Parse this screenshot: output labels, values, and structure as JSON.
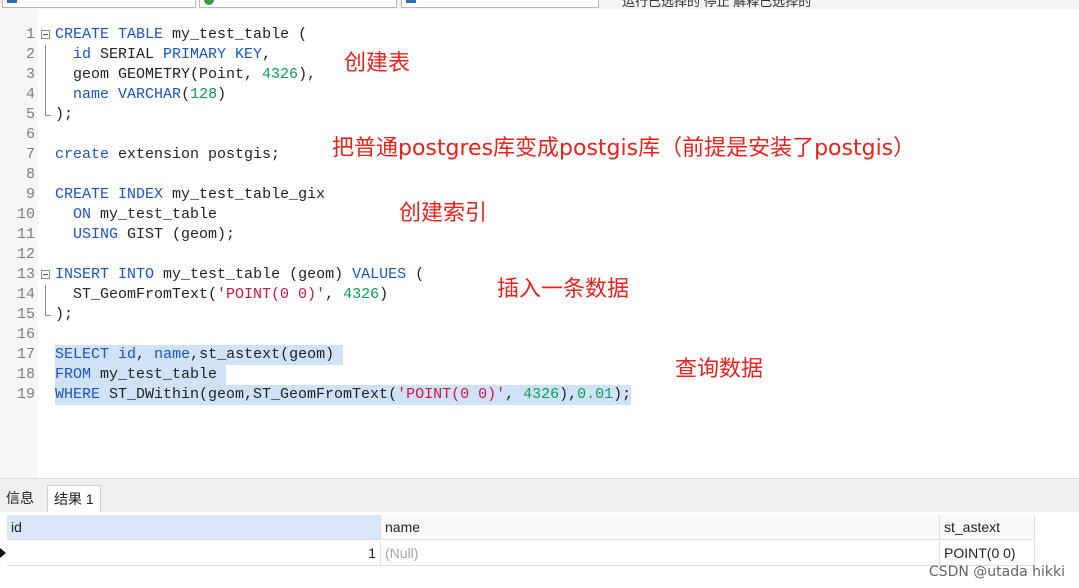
{
  "toolbar": {
    "partial_text": "运行已选择的    停止    解释已选择的"
  },
  "editor": {
    "lines": [
      {
        "n": "1",
        "fold": "start",
        "html": "<span class=\"kw\">CREATE</span> <span class=\"kw\">TABLE</span> my_test_table ("
      },
      {
        "n": "2",
        "fold": "mid",
        "html": "  <span class=\"kw\">id</span> SERIAL <span class=\"kw\">PRIMARY KEY</span>,"
      },
      {
        "n": "3",
        "fold": "mid",
        "html": "  geom GEOMETRY(Point, <span class=\"num\">4326</span>),"
      },
      {
        "n": "4",
        "fold": "mid",
        "html": "  <span class=\"kw\">name</span> <span class=\"kw\">VARCHAR</span>(<span class=\"num\">128</span>)"
      },
      {
        "n": "5",
        "fold": "end",
        "html": ");"
      },
      {
        "n": "6",
        "fold": "",
        "html": ""
      },
      {
        "n": "7",
        "fold": "",
        "html": "<span class=\"kw\">create</span> extension postgis;"
      },
      {
        "n": "8",
        "fold": "",
        "html": ""
      },
      {
        "n": "9",
        "fold": "",
        "html": "<span class=\"kw\">CREATE</span> <span class=\"kw\">INDEX</span> my_test_table_gix"
      },
      {
        "n": "10",
        "fold": "",
        "html": "  <span class=\"kw\">ON</span> my_test_table"
      },
      {
        "n": "11",
        "fold": "",
        "html": "  <span class=\"kw\">USING</span> GIST (geom);"
      },
      {
        "n": "12",
        "fold": "",
        "html": ""
      },
      {
        "n": "13",
        "fold": "start",
        "html": "<span class=\"kw\">INSERT</span> <span class=\"kw\">INTO</span> my_test_table (geom) <span class=\"kw\">VALUES</span> ("
      },
      {
        "n": "14",
        "fold": "mid",
        "html": "  ST_GeomFromText(<span class=\"str\">'POINT(0 0)'</span>, <span class=\"num\">4326</span>)"
      },
      {
        "n": "15",
        "fold": "end",
        "html": ");"
      },
      {
        "n": "16",
        "fold": "",
        "html": ""
      },
      {
        "n": "17",
        "fold": "",
        "hl": true,
        "html": "<span class=\"kw\">SELECT</span> <span class=\"kw\">id</span>, <span class=\"kw\">name</span>,st_astext(geom) "
      },
      {
        "n": "18",
        "fold": "",
        "hl": true,
        "html": "<span class=\"kw\">FROM</span> my_test_table "
      },
      {
        "n": "19",
        "fold": "",
        "hl": true,
        "html": "<span class=\"kw\">WHERE</span> ST_DWithin(geom,ST_GeomFromText(<span class=\"str\">'POINT(0 0)'</span>, <span class=\"num\">4326</span>),<span class=\"num\">0.01</span>);"
      }
    ]
  },
  "annotations": {
    "create_table": "创建表",
    "extension": "把普通postgres库变成postgis库（前提是安装了postgis）",
    "create_index": "创建索引",
    "insert": "插入一条数据",
    "query": "查询数据"
  },
  "result_panel": {
    "tabs": [
      "信息",
      "结果 1"
    ],
    "columns": [
      "id",
      "name",
      "st_astext"
    ],
    "rows": [
      {
        "id": "1",
        "name": "(Null)",
        "st_astext": "POINT(0 0)"
      }
    ]
  },
  "watermark": "CSDN @utada hikki"
}
